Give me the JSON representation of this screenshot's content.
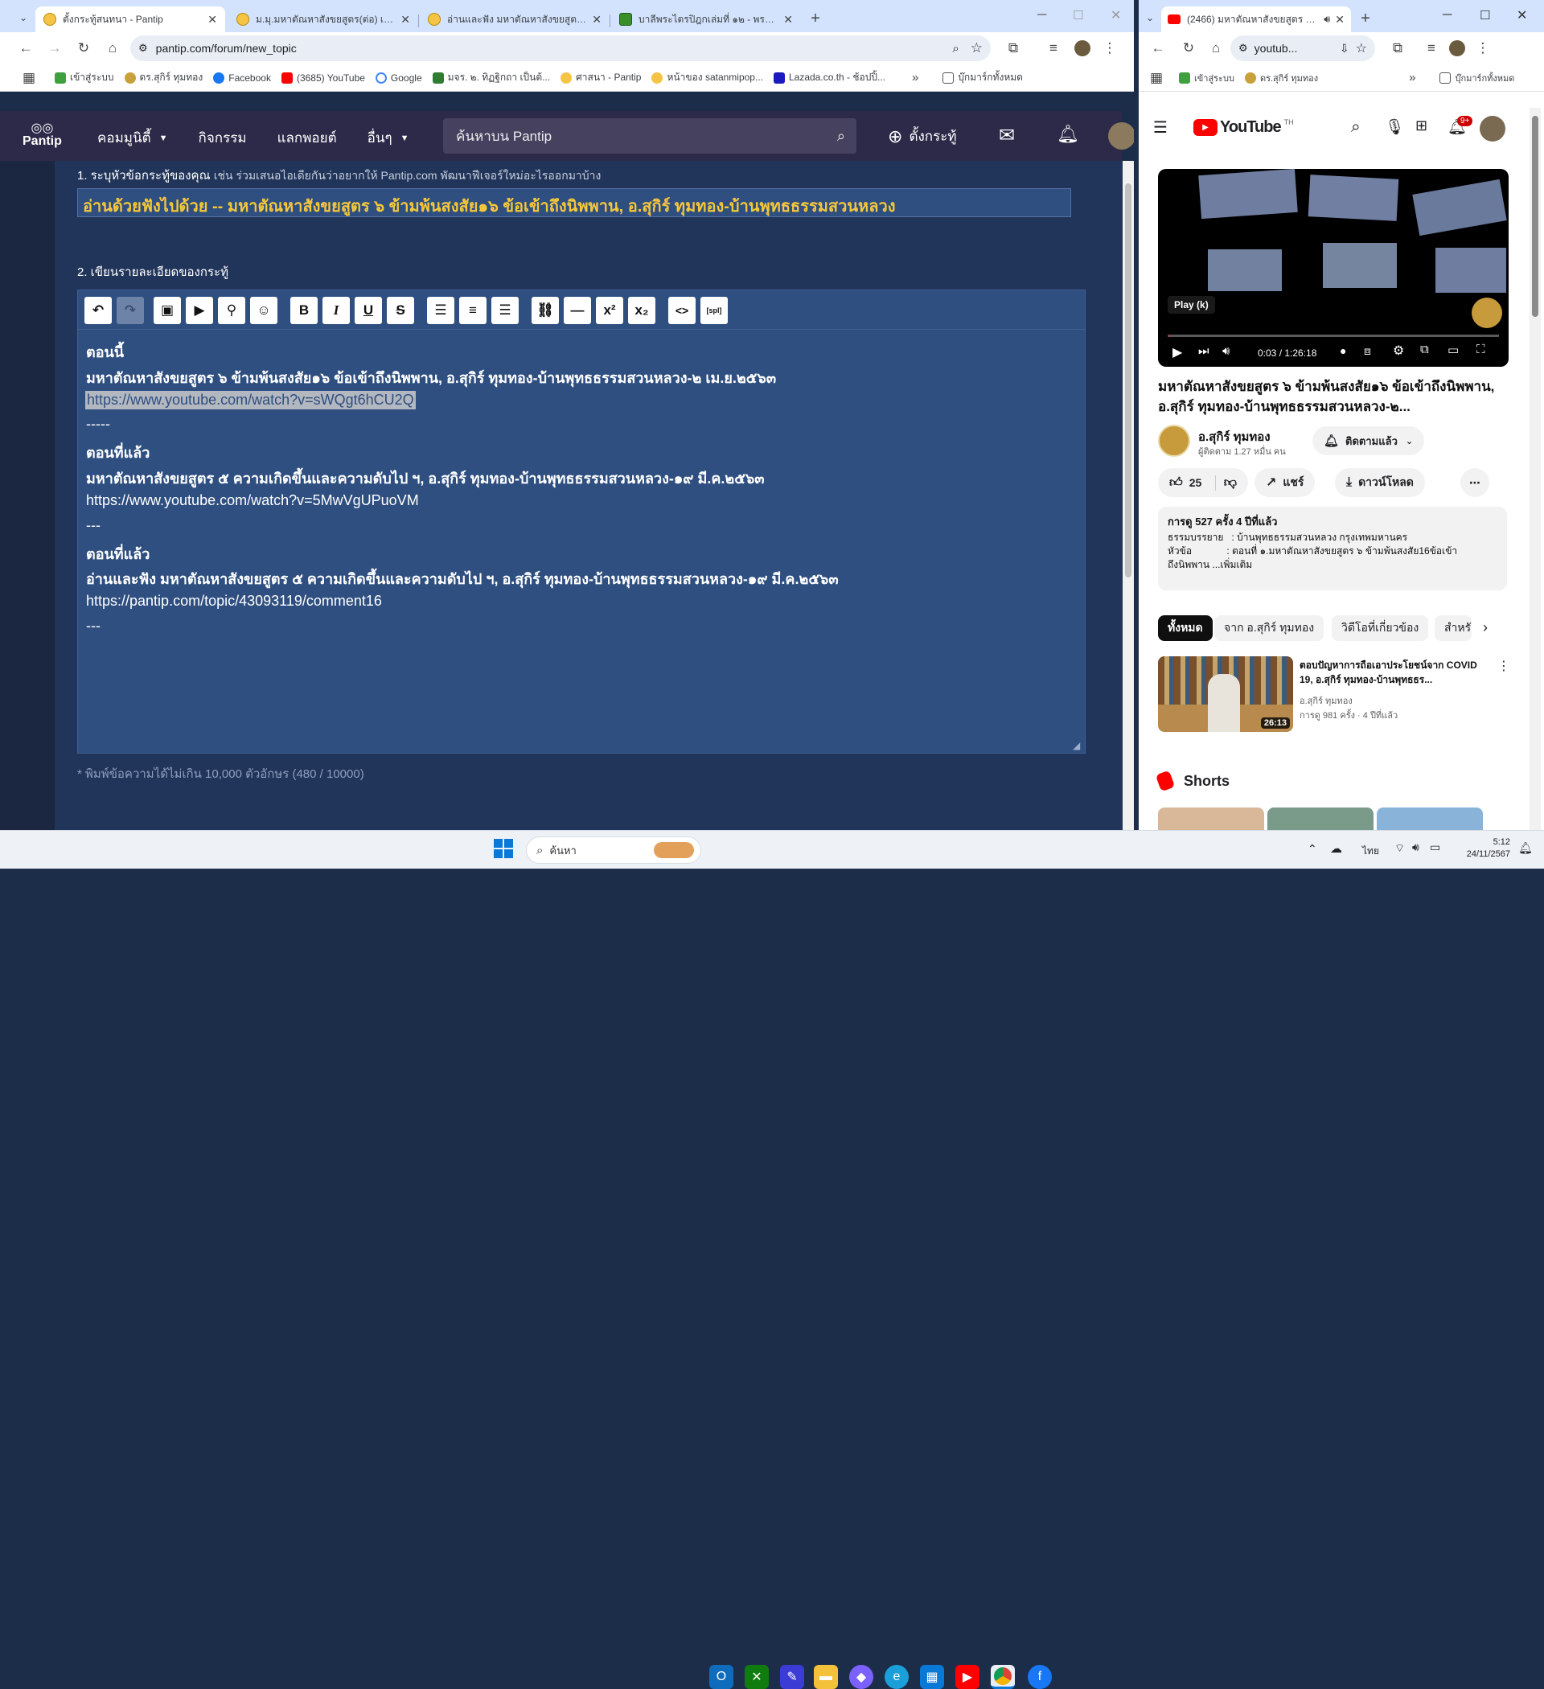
{
  "left_window": {
    "tabs": [
      {
        "title": "ตั้งกระทู้สนทนา - Pantip"
      },
      {
        "title": "ม.มุ.มหาตัณหาสังขยสูตร(ต่อ) เหตุปัจ..."
      },
      {
        "title": "อ่านและฟัง มหาตัณหาสังขยสูตร ๕ ค..."
      },
      {
        "title": "บาลีพระไตรปิฎกเล่มที่ ๑๒ - พระสุตต..."
      }
    ],
    "url": "pantip.com/forum/new_topic",
    "bookmarks": [
      "เข้าสู่ระบบ",
      "ดร.สุกิร์ ทุมทอง",
      "Facebook",
      "(3685) YouTube",
      "Google",
      "มจร. ๒. ทิฏฐิกถา เป็นต้...",
      "ศาสนา - Pantip",
      "หน้าของ satanmipop...",
      "Lazada.co.th - ช้อปปิ้...",
      "บุ๊กมาร์กทั้งหมด"
    ],
    "nav": {
      "logo": "Pantip",
      "menu": [
        "คอมมูนิตี้",
        "กิจกรรม",
        "แลกพอยต์",
        "อื่นๆ"
      ],
      "search_placeholder": "ค้นหาบน Pantip",
      "new_topic": "ตั้งกระทู้"
    },
    "form": {
      "step1_label": "1. ระบุหัวข้อกระทู้ของคุณ",
      "step1_hint": "เช่น ร่วมเสนอไอเดียกันว่าอยากให้ Pantip.com พัฒนาฟีเจอร์ใหม่อะไรออกมาบ้าง",
      "title_value": "อ่านด้วยฟังไปด้วย -- มหาตัณหาสังขยสูตร ๖ ข้ามพ้นสงสัย๑๖ ข้อเข้าถึงนิพพาน, อ.สุกิร์ ทุมทอง-บ้านพุทธธรรมสวนหลวง",
      "step2_label": "2. เขียนรายละเอียดของกระทู้",
      "editor_lines": [
        "ตอนนี้",
        "มหาตัณหาสังขยสูตร ๖ ข้ามพ้นสงสัย๑๖ ข้อเข้าถึงนิพพาน, อ.สุกิร์ ทุมทอง-บ้านพุทธธรรมสวนหลวง-๒ เม.ย.๒๕๖๓",
        "https://www.youtube.com/watch?v=sWQgt6hCU2Q",
        "-----",
        "ตอนที่แล้ว",
        "มหาตัณหาสังขยสูตร ๕ ความเกิดขึ้นและความดับไป ฯ, อ.สุกิร์ ทุมทอง-บ้านพุทธธรรมสวนหลวง-๑๙ มี.ค.๒๕๖๓",
        "https://www.youtube.com/watch?v=5MwVgUPuoVM",
        "---",
        "ตอนที่แล้ว",
        "อ่านและฟัง มหาตัณหาสังขยสูตร ๕ ความเกิดขึ้นและความดับไป ฯ, อ.สุกิร์ ทุมทอง-บ้านพุทธธรรมสวนหลวง-๑๙ มี.ค.๒๕๖๓",
        "https://pantip.com/topic/43093119/comment16",
        "---"
      ],
      "char_note": "* พิมพ์ข้อความได้ไม่เกิน 10,000 ตัวอักษร (480 / 10000)"
    }
  },
  "right_window": {
    "tab_title": "(2466) มหาตัณหาสังขยสูตร ๖ ข...",
    "url": "youtub...",
    "bookmarks": [
      "เข้าสู่ระบบ",
      "ดร.สุกิร์ ทุมทอง",
      "บุ๊กมาร์กทั้งหมด"
    ],
    "brand": "YouTube",
    "brand_sup": "TH",
    "notif_badge": "9+",
    "player": {
      "tooltip": "Play (k)",
      "time": "0:03 / 1:26:18"
    },
    "video_title": "มหาตัณหาสังขยสูตร ๖ ข้ามพ้นสงสัย๑๖ ข้อเข้าถึงนิพพาน, อ.สุกิร์ ทุมทอง-บ้านพุทธธรรมสวนหลวง-๒...",
    "channel": {
      "name": "อ.สุกิร์ ทุมทอง",
      "subs": "ผู้ติดตาม 1.27 หมื่น คน",
      "subscribed": "ติดตามแล้ว"
    },
    "actions": {
      "likes": "25",
      "share": "แชร์",
      "download": "ดาวน์โหลด"
    },
    "desc": {
      "views": "การดู 527 ครั้ง  4 ปีที่แล้ว",
      "line1": "ธรรมบรรยาย   : บ้านพุทธธรรมสวนหลวง กรุงเทพมหานคร",
      "line2": "หัวข้อ             : ตอนที่ ๑.มหาตัณหาสังขยสูตร ๖ ข้ามพ้นสงสัย16ข้อเข้า",
      "line3": "ถึงนิพพาน ...เพิ่มเติม"
    },
    "chips": [
      "ทั้งหมด",
      "จาก อ.สุกิร์ ทุมทอง",
      "วิดีโอที่เกี่ยวข้อง",
      "สำหรั"
    ],
    "rec": {
      "title": "ตอบปัญหาการถือเอาประโยชน์จาก COVID 19, อ.สุกิร์ ทุมทอง-บ้านพุทธธร...",
      "channel": "อ.สุกิร์ ทุมทอง",
      "meta": "การดู 981 ครั้ง · 4 ปีที่แล้ว",
      "duration": "26:13"
    },
    "shorts": "Shorts"
  },
  "taskbar": {
    "search": "ค้นหา",
    "lang": "ไทย",
    "time": "5:12",
    "date": "24/11/2567"
  }
}
